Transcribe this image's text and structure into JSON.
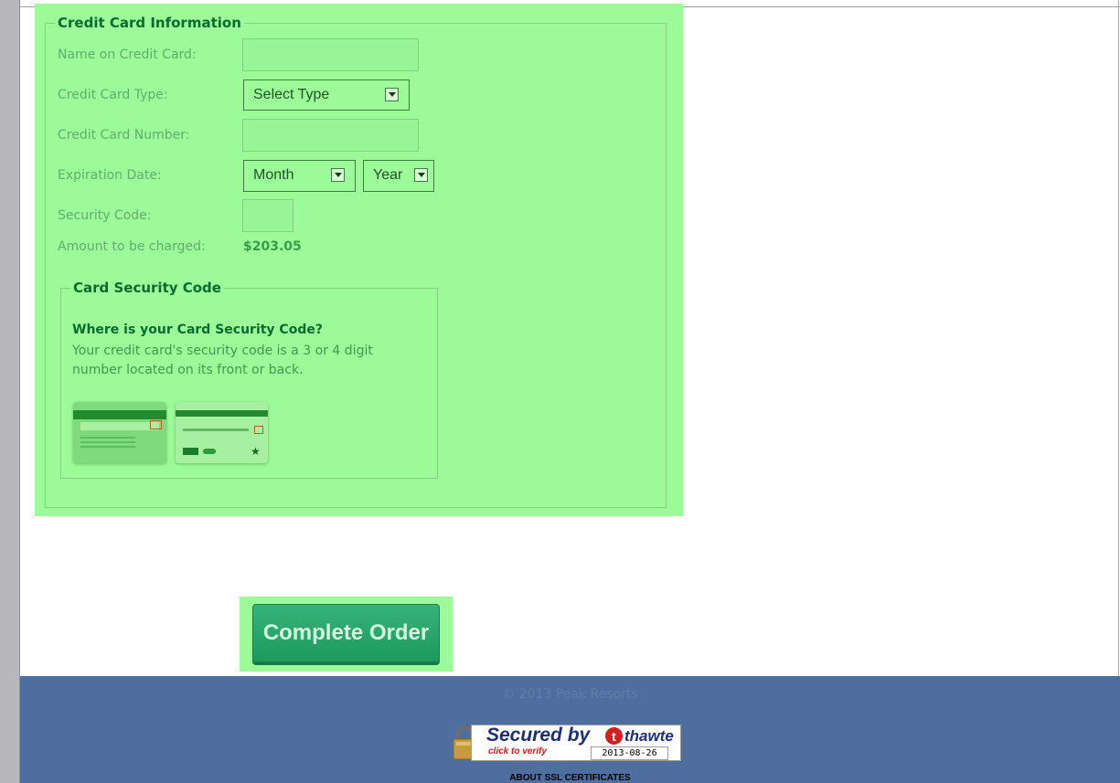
{
  "credit_card": {
    "legend": "Credit Card Information",
    "name_label": "Name on Credit Card:",
    "type_label": "Credit Card Type:",
    "type_value": "Select Type",
    "number_label": "Credit Card Number:",
    "exp_label": "Expiration Date:",
    "month_value": "Month",
    "year_value": "Year",
    "security_label": "Security Code:",
    "amount_label": "Amount to be charged:",
    "amount_value": "$203.05"
  },
  "card_security": {
    "legend": "Card Security Code",
    "question": "Where is your Card Security Code?",
    "description": "Your credit card's security code is a 3 or 4 digit number located on its front or back."
  },
  "actions": {
    "complete_order": "Complete Order"
  },
  "footer": {
    "copyright": "© 2013 Peak Resorts",
    "seal_secured": "Secured by",
    "seal_brand": "thawte",
    "seal_verify": "click to verify",
    "seal_date": "2013-08-26",
    "about_ssl": "ABOUT SSL CERTIFICATES"
  },
  "icons": {
    "dropdown": "chevron-down-icon",
    "lock": "lock-icon",
    "card_back": "credit-card-back-icon",
    "card_front": "credit-card-front-icon"
  }
}
